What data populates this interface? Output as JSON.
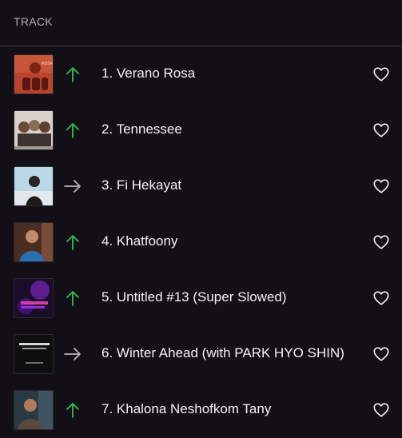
{
  "header": {
    "label": "TRACK"
  },
  "colors": {
    "trend_up": "#2fbf4f",
    "trend_same": "#b8b5bc",
    "background": "#121016"
  },
  "tracks": [
    {
      "label": "1. Verano Rosa",
      "trend": "up",
      "art_icon": "album-art-verano-rosa"
    },
    {
      "label": "2. Tennessee",
      "trend": "up",
      "art_icon": "album-art-tennessee"
    },
    {
      "label": "3. Fi Hekayat",
      "trend": "same",
      "art_icon": "album-art-fi-hekayat"
    },
    {
      "label": "4. Khatfoony",
      "trend": "up",
      "art_icon": "album-art-khatfoony"
    },
    {
      "label": "5. Untitled #13 (Super Slowed)",
      "trend": "up",
      "art_icon": "album-art-untitled-13"
    },
    {
      "label": "6. Winter Ahead (with PARK HYO SHIN)",
      "trend": "same",
      "art_icon": "album-art-winter-ahead"
    },
    {
      "label": "7. Khalona Neshofkom Tany",
      "trend": "up",
      "art_icon": "album-art-khalona"
    }
  ]
}
